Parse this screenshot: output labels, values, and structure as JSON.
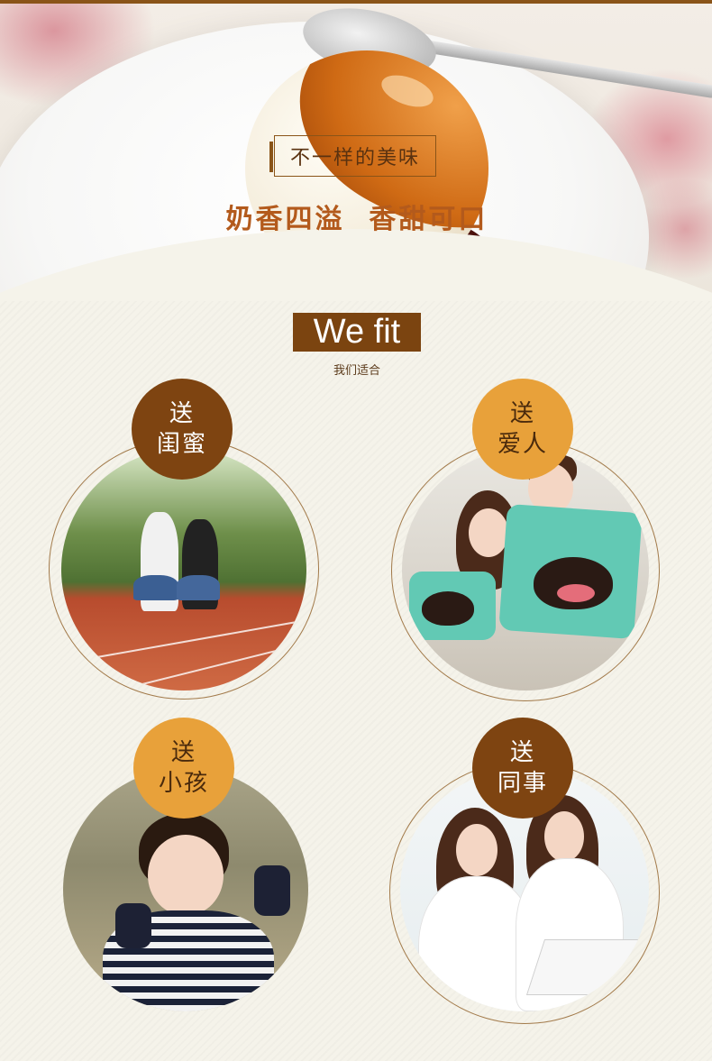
{
  "hero": {
    "tagline": "不一样的美味",
    "slogan": "奶香四溢  香甜可口"
  },
  "fit": {
    "title": "We fit",
    "subtitle": "我们适合"
  },
  "audiences": [
    {
      "line1": "送",
      "line2": "闺蜜"
    },
    {
      "line1": "送",
      "line2": "爱人"
    },
    {
      "line1": "送",
      "line2": "小孩"
    },
    {
      "line1": "送",
      "line2": "同事"
    }
  ],
  "colors": {
    "brand_dark": "#7e4411",
    "brand_light": "#e8a13a",
    "accent_text": "#b35a1c"
  }
}
